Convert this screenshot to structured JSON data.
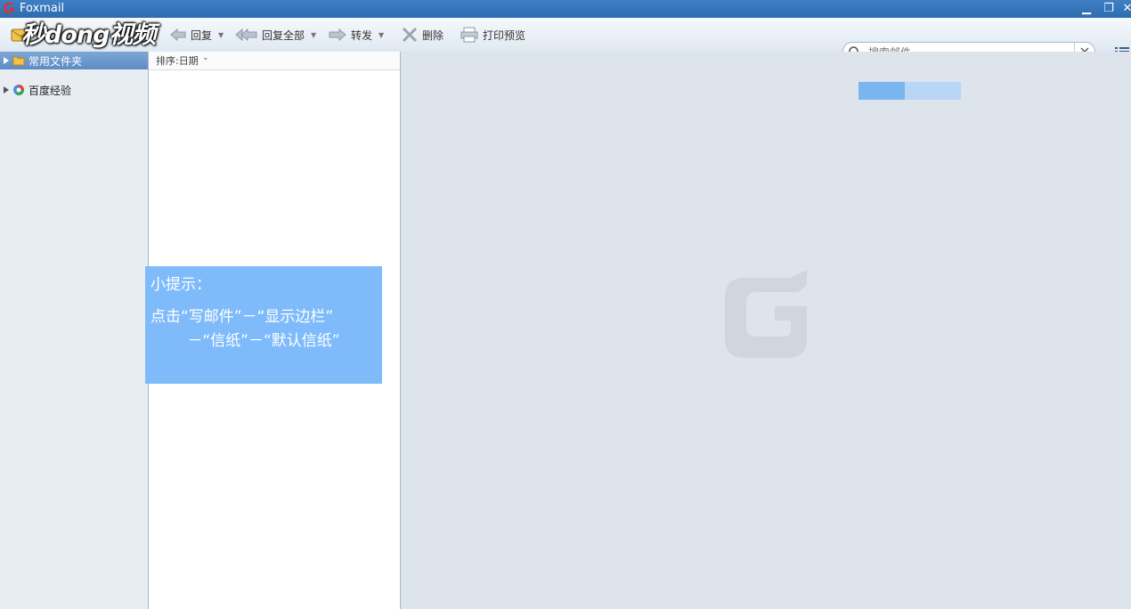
{
  "window": {
    "title": "Foxmail"
  },
  "toolbar": {
    "watermark": "秒dong视频",
    "reply": "回复",
    "reply_all": "回复全部",
    "forward": "转发",
    "delete": "删除",
    "print_preview": "打印预览"
  },
  "search": {
    "placeholder": "搜索邮件"
  },
  "folders": {
    "header_label": "常用文件夹",
    "items": [
      {
        "label": "百度经验"
      }
    ]
  },
  "mail_list": {
    "sort_label": "排序:日期"
  },
  "reading_pane": {
    "progress_fraction": 0.45
  },
  "tip": {
    "title": "小提示：",
    "line1": "点击“写邮件”－“显示边栏”",
    "line2": "－“信纸”－“默认信纸”"
  },
  "colors": {
    "titlebar": "#3f7fc4",
    "tip_background": "#7fbbfb",
    "progress_fill": "#7bb5f0",
    "progress_track": "#b8d6f5"
  }
}
